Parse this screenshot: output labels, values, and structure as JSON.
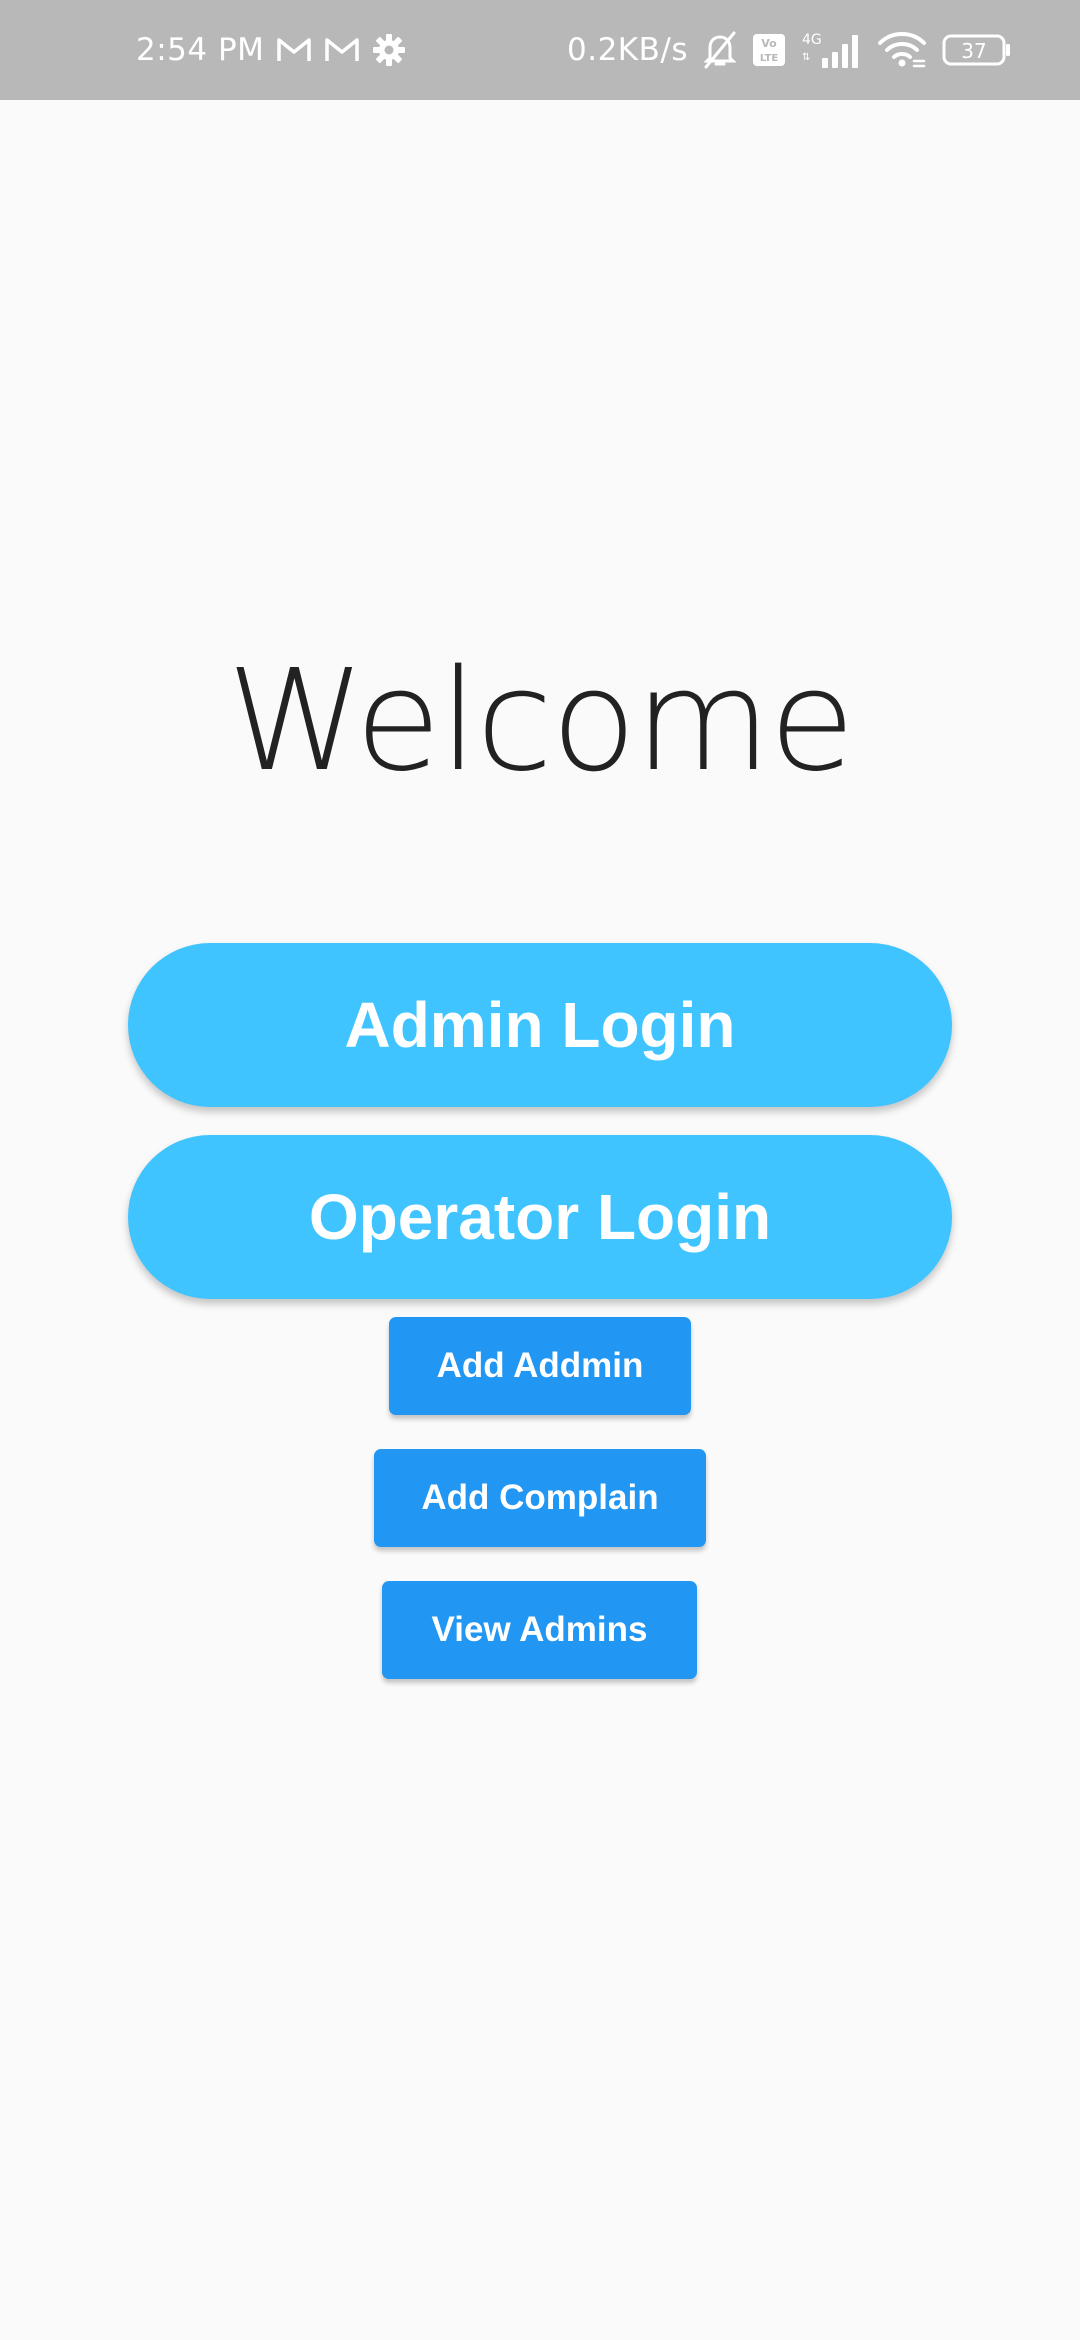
{
  "status_bar": {
    "time": "2:54 PM",
    "net_speed": "0.2KB/s",
    "network_type": "4G",
    "volte_label": "Vo LTE",
    "battery_level": "37",
    "background_color": "#b8b8b8",
    "left_icons": [
      "gmail-icon",
      "gmail-icon",
      "settings-gear-icon"
    ],
    "right_icons": [
      "mute-bell-icon",
      "volte-icon",
      "signal-icon",
      "wifi-icon",
      "battery-icon"
    ]
  },
  "main": {
    "title": "Welcome",
    "buttons": {
      "admin_login": "Admin Login",
      "operator_login": "Operator Login",
      "add_admin": "Add Addmin",
      "add_complain": "Add Complain",
      "view_admins": "View Admins"
    }
  },
  "colors": {
    "background": "#fafafa",
    "primary_pill": "#40c4ff",
    "secondary_button": "#2196f3",
    "title_text": "#222222"
  }
}
